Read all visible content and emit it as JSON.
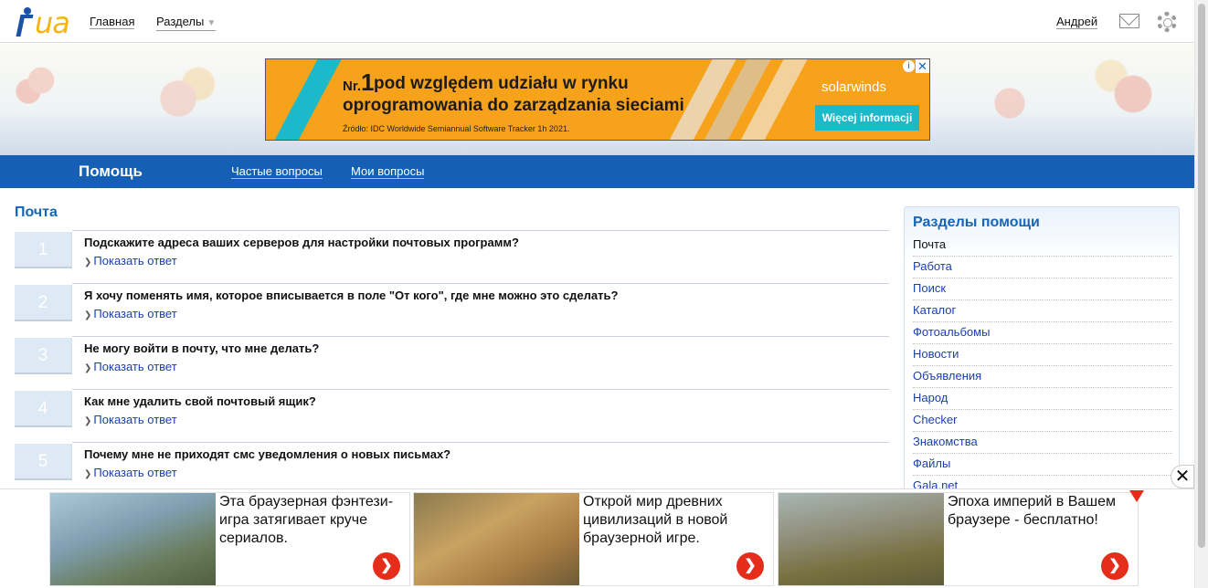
{
  "header": {
    "logo_text": "ua",
    "nav": {
      "main": "Главная",
      "sections": "Разделы"
    },
    "user": "Андрей",
    "icons": [
      "mail-icon",
      "gear-icon"
    ]
  },
  "ad_banner": {
    "nr_prefix": "Nr.",
    "nr_number": "1",
    "line1": "pod względem udziału w rynku",
    "line2": "oprogramowania do zarządzania sieciami",
    "source": "Źródło: IDC Worldwide Semiannual Software Tracker 1h 2021.",
    "brand": "solarwinds",
    "button": "Więcej informacji",
    "colors": {
      "background": "#f7a21b",
      "button": "#1bb9c9"
    }
  },
  "helpbar": {
    "title": "Помощь",
    "links": {
      "faq": "Частые вопросы",
      "mine": "Мои вопросы"
    },
    "color": "#1560b5"
  },
  "main": {
    "section_title": "Почта",
    "show_answer_label": "Показать ответ",
    "questions": [
      {
        "num": "1",
        "text": "Подскажите адреса ваших серверов для настройки почтовых программ?"
      },
      {
        "num": "2",
        "text": "Я хочу поменять имя, которое вписывается в поле \"От кого\", где мне можно это сделать?"
      },
      {
        "num": "3",
        "text": "Не могу войти в почту, что мне делать?"
      },
      {
        "num": "4",
        "text": "Как мне удалить свой почтовый ящик?"
      },
      {
        "num": "5",
        "text": "Почему мне не приходят смс уведомления о новых письмах?"
      }
    ]
  },
  "sidebar": {
    "title": "Разделы помощи",
    "items": [
      "Почта",
      "Работа",
      "Поиск",
      "Каталог",
      "Фотоальбомы",
      "Новости",
      "Объявления",
      "Народ",
      "Checker",
      "Знакомства",
      "Файлы",
      "Gala.net"
    ],
    "current": "Почта"
  },
  "bottom_ads": [
    {
      "text": "Эта браузерная фэнтези-игра затягивает круче сериалов."
    },
    {
      "text": "Открой мир древних цивилизаций в новой браузерной игре."
    },
    {
      "text": "Эпоха империй в Вашем браузере - бесплатно!"
    }
  ],
  "accent_color": "#1565b5",
  "link_color": "#1a3fb0"
}
